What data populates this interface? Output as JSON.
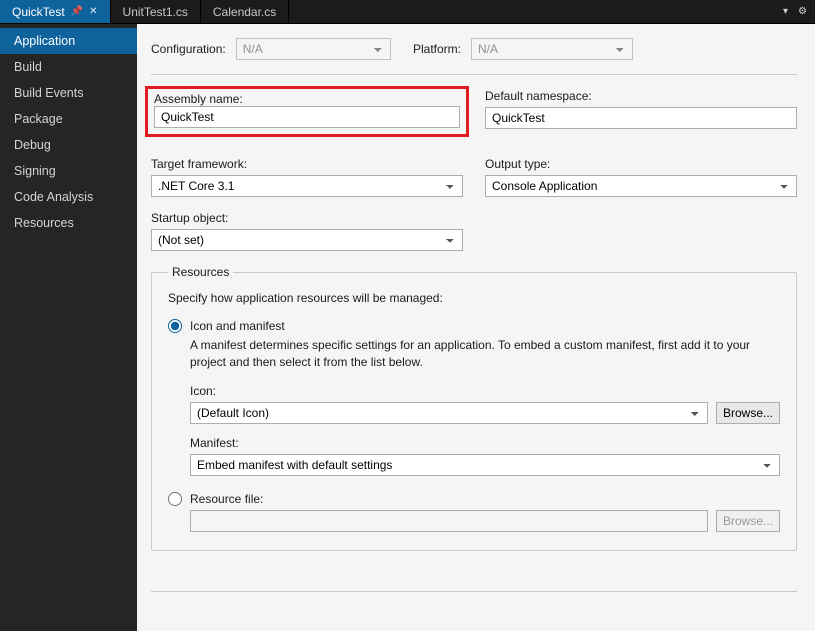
{
  "tabs": [
    {
      "label": "QuickTest",
      "active": true,
      "pinned": true
    },
    {
      "label": "UnitTest1.cs",
      "active": false,
      "pinned": false
    },
    {
      "label": "Calendar.cs",
      "active": false,
      "pinned": false
    }
  ],
  "sidebar": {
    "items": [
      {
        "label": "Application",
        "active": true
      },
      {
        "label": "Build",
        "active": false
      },
      {
        "label": "Build Events",
        "active": false
      },
      {
        "label": "Package",
        "active": false
      },
      {
        "label": "Debug",
        "active": false
      },
      {
        "label": "Signing",
        "active": false
      },
      {
        "label": "Code Analysis",
        "active": false
      },
      {
        "label": "Resources",
        "active": false
      }
    ]
  },
  "top": {
    "configuration_label": "Configuration:",
    "configuration_value": "N/A",
    "platform_label": "Platform:",
    "platform_value": "N/A"
  },
  "assembly": {
    "name_label": "Assembly name:",
    "name_value": "QuickTest",
    "namespace_label": "Default namespace:",
    "namespace_value": "QuickTest"
  },
  "framework": {
    "target_label": "Target framework:",
    "target_value": ".NET Core 3.1",
    "output_label": "Output type:",
    "output_value": "Console Application"
  },
  "startup": {
    "label": "Startup object:",
    "value": "(Not set)"
  },
  "resources": {
    "legend": "Resources",
    "description": "Specify how application resources will be managed:",
    "icon_manifest_label": "Icon and manifest",
    "icon_manifest_desc": "A manifest determines specific settings for an application. To embed a custom manifest, first add it to your project and then select it from the list below.",
    "icon_label": "Icon:",
    "icon_value": "(Default Icon)",
    "manifest_label": "Manifest:",
    "manifest_value": "Embed manifest with default settings",
    "resource_file_label": "Resource file:",
    "browse_label": "Browse..."
  }
}
